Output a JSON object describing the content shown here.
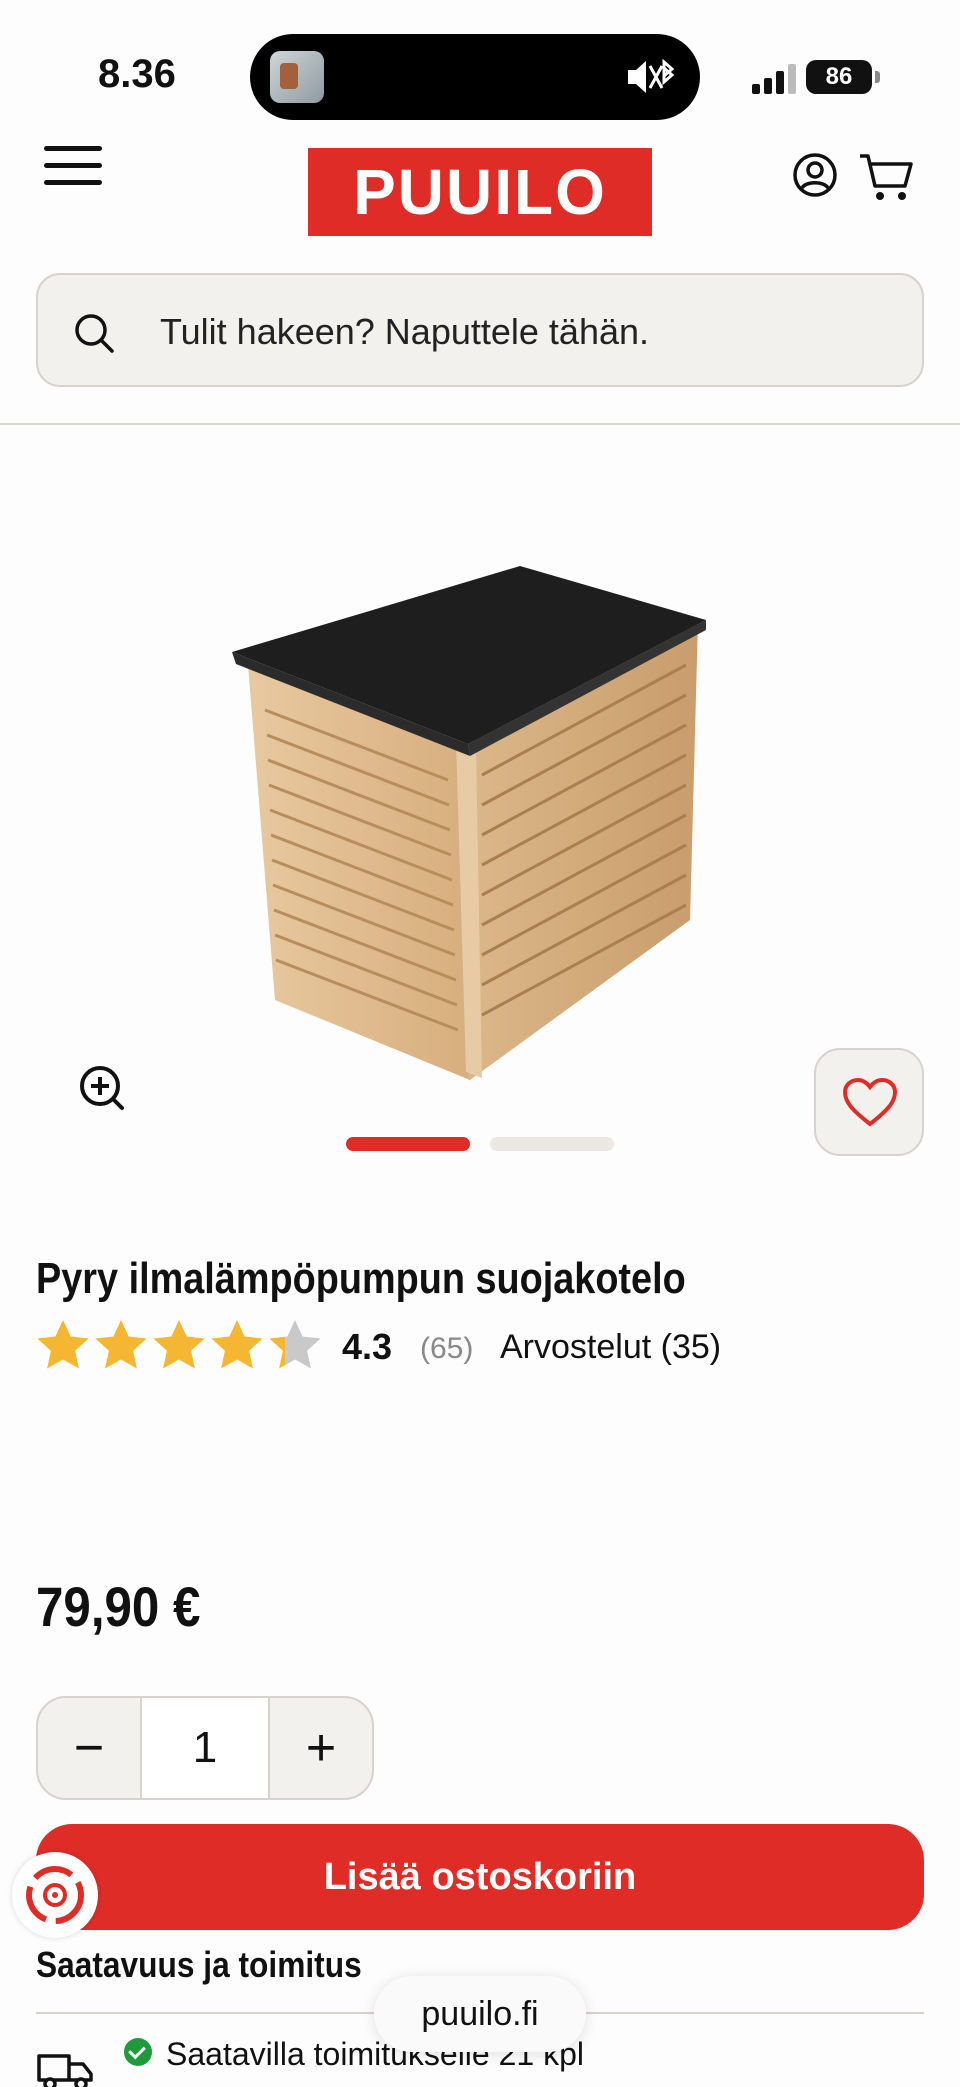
{
  "status_bar": {
    "time": "8.36",
    "battery": "86"
  },
  "header": {
    "logo_text": "PUUILO",
    "brand_color": "#e02c27"
  },
  "search": {
    "placeholder": "Tulit hakeen? Naputtele tähän."
  },
  "product": {
    "title": "Pyry ilmalämpöpumpun suojakotelo",
    "rating": "4.3",
    "rating_count": "(65)",
    "rating_value": 4.3,
    "rating_max": 5,
    "reviews_label": "Arvostelut (35)",
    "price": "79,90 €",
    "image_count": 2,
    "active_image": 1
  },
  "quantity": {
    "minus": "−",
    "value": "1",
    "plus": "+"
  },
  "actions": {
    "add_to_cart": "Lisää ostoskoriin"
  },
  "availability": {
    "heading": "Saatavuus ja toimitus",
    "delivery_text": "Saatavilla toimitukselle 21 kpl",
    "status_color": "#1e9a3b"
  },
  "browser": {
    "url": "puuilo.fi"
  }
}
